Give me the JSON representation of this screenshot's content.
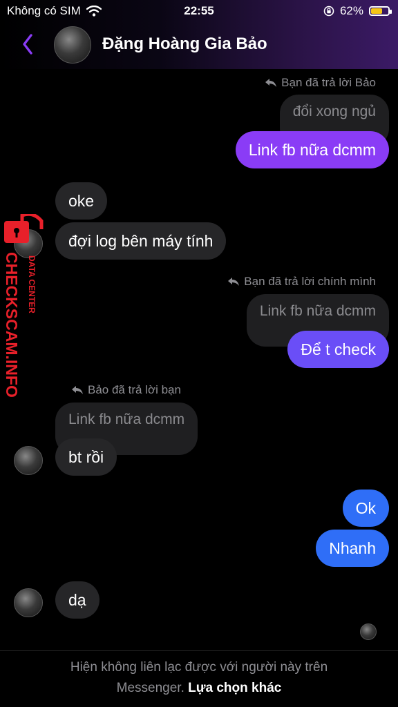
{
  "status_bar": {
    "carrier": "Không có SIM",
    "time": "22:55",
    "battery_percent": "62%",
    "battery_level": 0.62
  },
  "header": {
    "contact_name": "Đặng Hoàng Gia Bảo"
  },
  "messages": {
    "reply1_label": "Bạn đã trả lời Bảo",
    "reply1_quote": "đổi xong ngủ",
    "reply1_text": "Link fb nữa dcmm",
    "in1": "oke",
    "in2": "đợi log bên máy tính",
    "reply2_label": "Bạn đã trả lời chính mình",
    "reply2_quote": "Link fb nữa dcmm",
    "reply2_text": "Để t check",
    "reply3_label": "Bảo đã trả lời bạn",
    "reply3_quote": "Link fb nữa dcmm",
    "reply3_text": "bt rồi",
    "out1": "Ok",
    "out2": "Nhanh",
    "in3": "dạ"
  },
  "footer": {
    "notice_line1": "Hiện không liên lạc được với người này trên",
    "notice_line2": "Messenger.",
    "action": "Lựa chọn khác"
  },
  "watermark": {
    "brand": "CHECKSCAM.INFO",
    "tagline": "DATA CENTER"
  },
  "colors": {
    "purple": "#8a3cf6",
    "indigo": "#6a4ef7",
    "blue": "#2f6ef7"
  }
}
